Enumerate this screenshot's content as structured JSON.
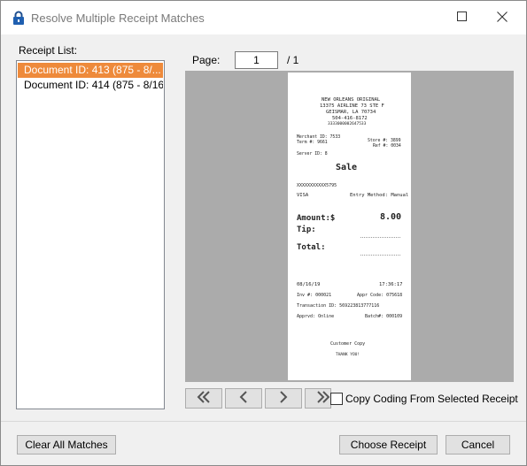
{
  "window": {
    "title": "Resolve Multiple Receipt Matches"
  },
  "receipt_list": {
    "label": "Receipt List:",
    "items": [
      {
        "label": "Document ID: 413 (875 - 8/..."
      },
      {
        "label": "Document ID: 414 (875 - 8/16..."
      }
    ]
  },
  "pager": {
    "label": "Page:",
    "current": "1",
    "total": "/ 1"
  },
  "receipt": {
    "store_name": "NEW ORLEANS ORIGINAL",
    "address1": "13375 AIRLINE 73 STE F",
    "address2": "GEISMAR, LA 70734",
    "phone": "504-416-8172",
    "store_no_line": "3333000002647533",
    "merchant_id": "Merchant ID: 7533",
    "term_no": "Term #: 9661",
    "store_no": "Store #: 3899",
    "ref_no": "Ref #: 0034",
    "server_id": "Server ID: 8",
    "sale": "Sale",
    "card": "XXXXXXXXXXX5795",
    "card_type": "VISA",
    "entry_method": "Entry Method: Manual",
    "amount_label": "Amount:$",
    "amount_value": "8.00",
    "tip_label": "Tip:",
    "total_label": "Total:",
    "date": "08/16/19",
    "time": "17:36:17",
    "inv": "Inv #: 000021",
    "appr": "Appr Code: 075618",
    "txn": "Transaction ID: 569223813777116",
    "approved": "Apprvd: Online",
    "batch": "Batch#: 000109",
    "copy": "Customer Copy",
    "thanks": "THANK YOU!"
  },
  "copy_coding": {
    "label": "Copy Coding From Selected Receipt"
  },
  "buttons": {
    "clear_all": "Clear All Matches",
    "choose": "Choose Receipt",
    "cancel": "Cancel"
  },
  "colors": {
    "selection": "#ee8a3b",
    "viewer_bg": "#ababab"
  }
}
